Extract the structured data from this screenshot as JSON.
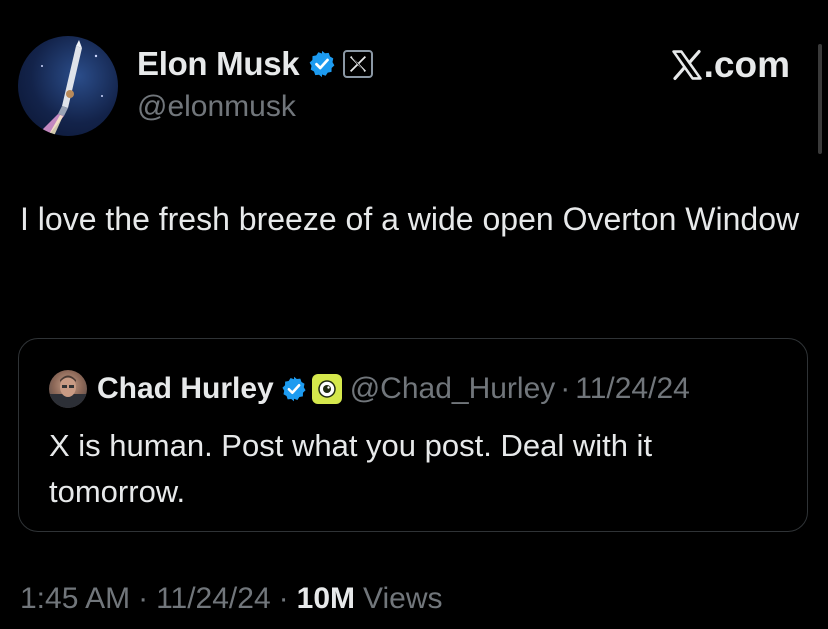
{
  "colors": {
    "background": "#000000",
    "text_primary": "#e7e9ea",
    "text_secondary": "#71767b",
    "verified_blue": "#1d9bf0",
    "border": "#2f3336"
  },
  "author": {
    "name": "Elon Musk",
    "handle": "@elonmusk",
    "verified_icon": "verified-badge-icon",
    "affiliate_icon": "x-logo-badge-icon",
    "avatar_icon": "rocket-launch-avatar"
  },
  "watermark": {
    "logo_icon": "x-logo-icon",
    "label": ".com"
  },
  "tweet": {
    "text": "I love the fresh breeze of a wide open Overton Window"
  },
  "quoted_tweet": {
    "name": "Chad Hurley",
    "handle": "@Chad_Hurley",
    "separator": "·",
    "date": "11/24/24",
    "text": "X is human. Post what you post. Deal with it tomorrow.",
    "verified_icon": "verified-badge-icon",
    "org_icon": "eye-org-badge-icon"
  },
  "meta": {
    "time": "1:45 AM",
    "sep1": "·",
    "date": "11/24/24",
    "sep2": "·",
    "views_count": "10M",
    "views_label": "Views"
  }
}
